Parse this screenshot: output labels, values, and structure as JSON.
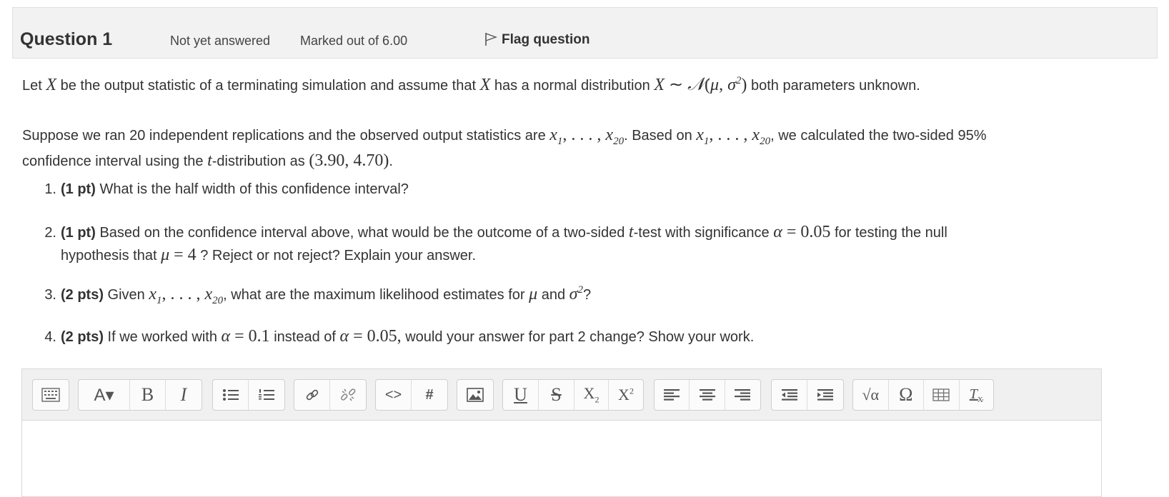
{
  "header": {
    "title": "Question 1",
    "state": "Not yet answered",
    "marked": "Marked out of 6.00",
    "flag_label": "Flag question"
  },
  "para1": {
    "t1": "Let ",
    "t2": " be the output statistic of a terminating simulation and assume that ",
    "t3": " has a normal distribution ",
    "t4": " both parameters unknown."
  },
  "para2": {
    "line1_a": "Suppose we ran 20 independent replications and the observed output statistics are ",
    "line1_b": ". Based on ",
    "line1_c": ", we calculated the two-sided 95%",
    "line2_a": "confidence interval using the ",
    "line2_b": "-distribution as ",
    "line2_c": "."
  },
  "questions": [
    {
      "num": "1.",
      "pts": "(1 pt)",
      "text": " What is the half width of this confidence interval?"
    },
    {
      "num": "2.",
      "pts": "(1 pt)",
      "text_a": " Based on the confidence interval above, what would be the outcome of a two-sided ",
      "text_b": "-test with significance ",
      "text_c": " for testing the null",
      "line2_a": "hypothesis that ",
      "line2_b": " ? Reject or not reject? Explain your answer."
    },
    {
      "num": "3.",
      "pts": "(2 pts)",
      "text_a": " Given ",
      "text_b": ", what are the maximum likelihood estimates for ",
      "text_c": " and ",
      "text_d": "?"
    },
    {
      "num": "4.",
      "pts": "(2 pts)",
      "text_a": " If we worked with ",
      "text_b": " instead of ",
      "text_c": " would your answer for part 2 change? Show your work."
    }
  ],
  "toolbar_buttons": [
    "toolbar-toggle",
    "font-color",
    "bold",
    "italic",
    "unordered-list",
    "ordered-list",
    "link",
    "unlink",
    "code",
    "hashtag",
    "image",
    "underline",
    "strikethrough",
    "subscript",
    "superscript",
    "align-left",
    "align-center",
    "align-right",
    "outdent",
    "indent",
    "equation",
    "special-characters",
    "table",
    "clear-formatting"
  ]
}
